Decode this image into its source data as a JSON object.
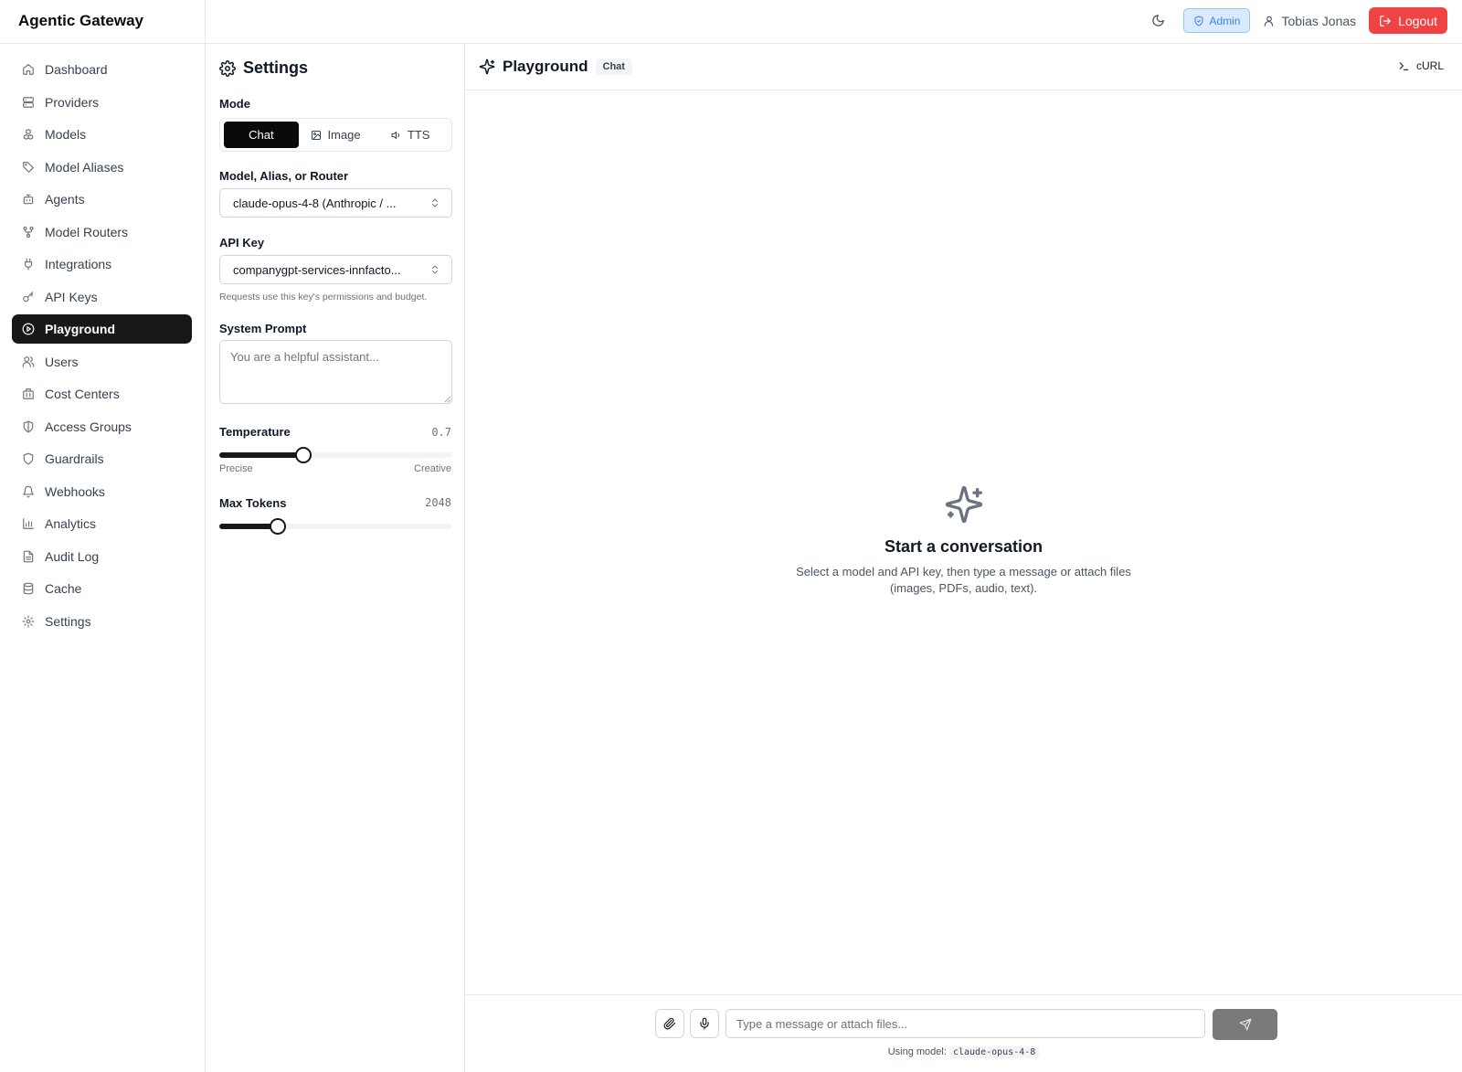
{
  "app": {
    "title": "Agentic Gateway"
  },
  "topbar": {
    "theme_icon": "moon-icon",
    "role_badge": "Admin",
    "user_name": "Tobias Jonas",
    "logout_label": "Logout",
    "logout_color": "#ef4444"
  },
  "sidebar": {
    "items": [
      {
        "label": "Dashboard",
        "icon": "home-icon"
      },
      {
        "label": "Providers",
        "icon": "server-icon"
      },
      {
        "label": "Models",
        "icon": "boxes-icon"
      },
      {
        "label": "Model Aliases",
        "icon": "tag-icon"
      },
      {
        "label": "Agents",
        "icon": "bot-icon"
      },
      {
        "label": "Model Routers",
        "icon": "git-fork-icon"
      },
      {
        "label": "Integrations",
        "icon": "plug-icon"
      },
      {
        "label": "API Keys",
        "icon": "key-icon"
      },
      {
        "label": "Playground",
        "icon": "play-circle-icon",
        "active": true
      },
      {
        "label": "Users",
        "icon": "users-icon"
      },
      {
        "label": "Cost Centers",
        "icon": "building-icon"
      },
      {
        "label": "Access Groups",
        "icon": "shield-half-icon"
      },
      {
        "label": "Guardrails",
        "icon": "shield-icon"
      },
      {
        "label": "Webhooks",
        "icon": "bell-icon"
      },
      {
        "label": "Analytics",
        "icon": "bar-chart-icon"
      },
      {
        "label": "Audit Log",
        "icon": "file-text-icon"
      },
      {
        "label": "Cache",
        "icon": "database-icon"
      },
      {
        "label": "Settings",
        "icon": "gear-icon"
      }
    ]
  },
  "settings": {
    "title": "Settings",
    "mode_label": "Mode",
    "modes": [
      {
        "label": "Chat",
        "active": true
      },
      {
        "label": "Image",
        "icon": "image-icon"
      },
      {
        "label": "TTS",
        "icon": "volume-icon"
      }
    ],
    "model_label": "Model, Alias, or Router",
    "model_value": "claude-opus-4-8 (Anthropic / ...",
    "api_key_label": "API Key",
    "api_key_value": "companygpt-services-innfacto...",
    "api_key_hint": "Requests use this key's permissions and budget.",
    "system_prompt_label": "System Prompt",
    "system_prompt_placeholder": "You are a helpful assistant...",
    "temperature": {
      "label": "Temperature",
      "value": "0.7",
      "fraction": 0.36,
      "min_label": "Precise",
      "max_label": "Creative"
    },
    "max_tokens": {
      "label": "Max Tokens",
      "value": "2048",
      "fraction": 0.25
    }
  },
  "main": {
    "title": "Playground",
    "badge": "Chat",
    "curl_label": "cURL",
    "empty_title": "Start a conversation",
    "empty_desc": "Select a model and API key, then type a message or attach files (images, PDFs, audio, text).",
    "input_placeholder": "Type a message or attach files...",
    "using_model_label": "Using model:",
    "using_model_value": "claude-opus-4-8"
  }
}
